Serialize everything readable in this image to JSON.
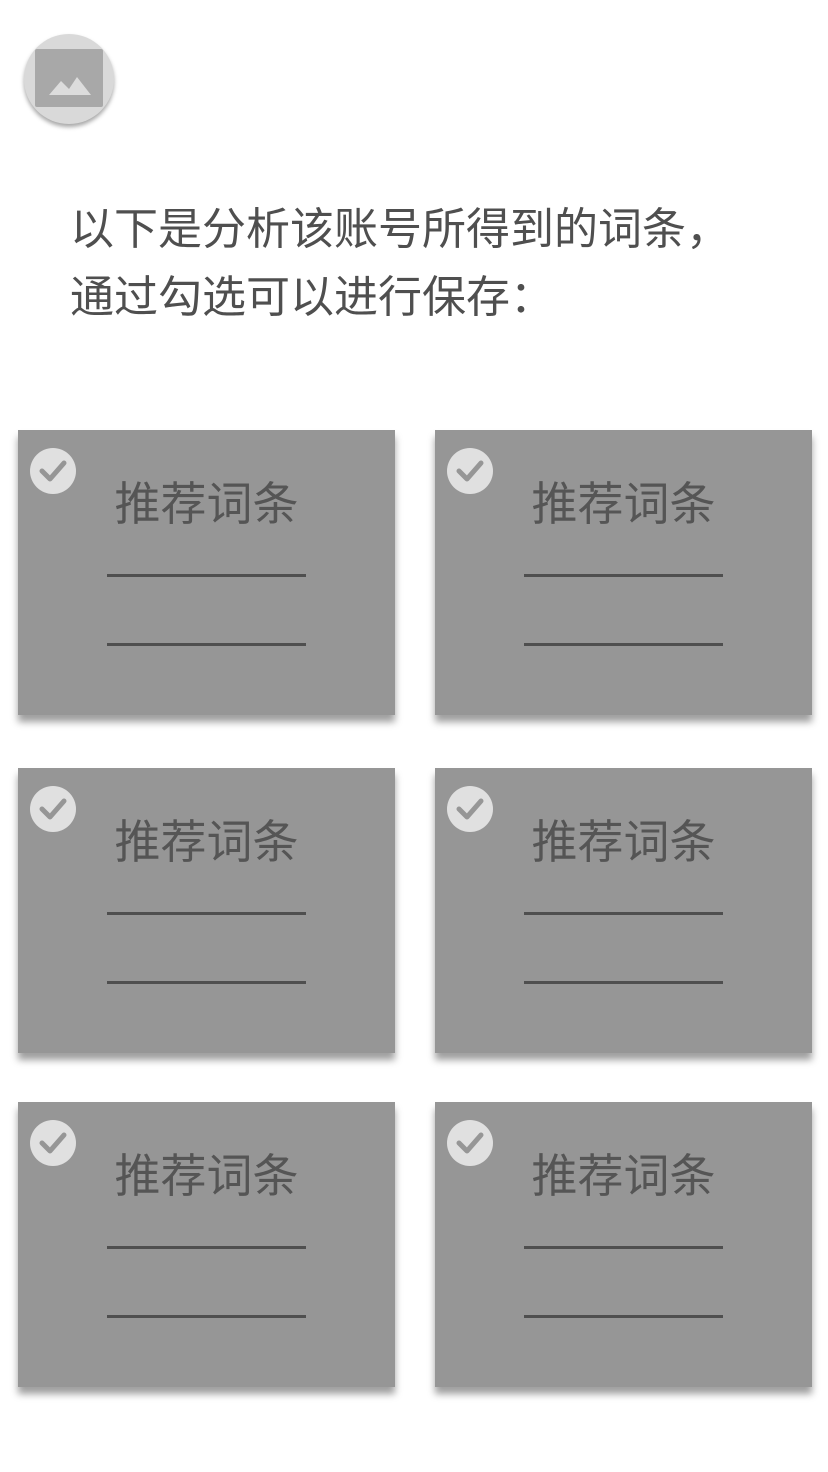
{
  "header": {
    "avatar_icon": "image-placeholder-icon"
  },
  "intro": {
    "line1": "以下是分析该账号所得到的词条，",
    "line2": "通过勾选可以进行保存："
  },
  "colors": {
    "card_background": "#969696",
    "check_circle": "#e0e0e0",
    "check_mark": "#969696",
    "text": "#555555"
  },
  "cards": [
    {
      "title": "推荐词条",
      "checked": true
    },
    {
      "title": "推荐词条",
      "checked": true
    },
    {
      "title": "推荐词条",
      "checked": true
    },
    {
      "title": "推荐词条",
      "checked": true
    },
    {
      "title": "推荐词条",
      "checked": true
    },
    {
      "title": "推荐词条",
      "checked": true
    }
  ]
}
